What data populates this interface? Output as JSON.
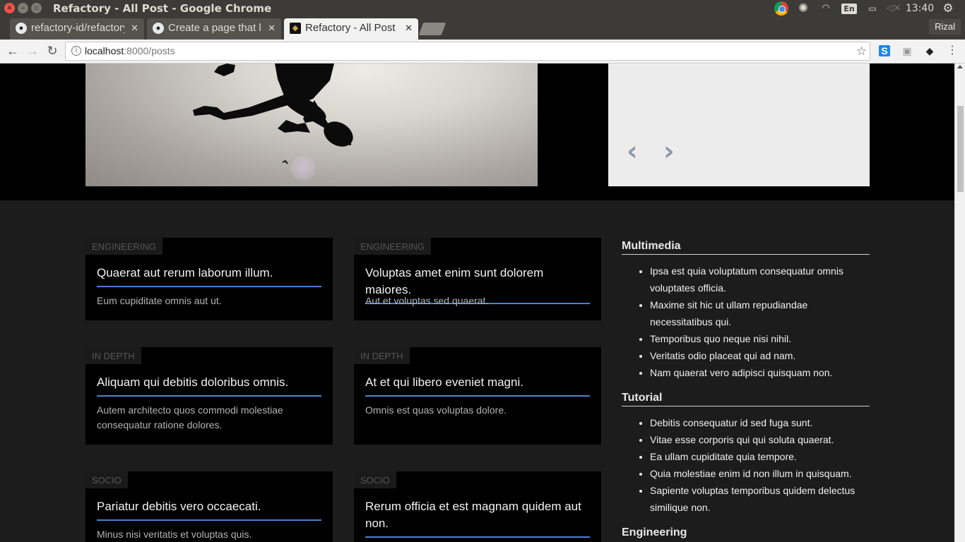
{
  "window": {
    "title": "Refactory - All Post - Google Chrome",
    "tray": {
      "lang": "En",
      "time": "13:40"
    }
  },
  "browser": {
    "tabs": [
      {
        "title": "refactory-id/refactory",
        "favicon": "github-icon",
        "active": false
      },
      {
        "title": "Create a page that lists",
        "favicon": "github-icon",
        "active": false
      },
      {
        "title": "Refactory - All Post",
        "favicon": "site-icon",
        "active": true
      }
    ],
    "profile": "Rizal",
    "url_host": "localhost",
    "url_path": ":8000/posts"
  },
  "hero": {
    "prev_label": "‹",
    "next_label": "›"
  },
  "posts": [
    {
      "category": "Engineering",
      "title": "Quaerat aut rerum laborum illum.",
      "excerpt": "Eum cupiditate omnis aut ut."
    },
    {
      "category": "Engineering",
      "title": "Voluptas amet enim sunt dolorem maiores.",
      "excerpt": "Aut et voluptas sed quaerat."
    },
    {
      "category": "In Depth",
      "title": "Aliquam qui debitis doloribus omnis.",
      "excerpt": "Autem architecto quos commodi molestiae consequatur ratione dolores."
    },
    {
      "category": "In Depth",
      "title": "At et qui libero eveniet magni.",
      "excerpt": "Omnis est quas voluptas dolore."
    },
    {
      "category": "Socio",
      "title": "Pariatur debitis vero occaecati.",
      "excerpt": "Minus nisi veritatis et voluptas quis."
    },
    {
      "category": "Socio",
      "title": "Rerum officia et est magnam quidem aut non.",
      "excerpt": ""
    }
  ],
  "sidebar": {
    "sections": [
      {
        "heading": "Multimedia",
        "items": [
          "Ipsa est quia voluptatum consequatur omnis voluptates officia.",
          "Maxime sit hic ut ullam repudiandae necessitatibus qui.",
          "Temporibus quo neque nisi nihil.",
          "Veritatis odio placeat qui ad nam.",
          "Nam quaerat vero adipisci quisquam non."
        ]
      },
      {
        "heading": "Tutorial",
        "items": [
          "Debitis consequatur id sed fuga sunt.",
          "Vitae esse corporis qui qui soluta quaerat.",
          "Ea ullam cupiditate quia tempore.",
          "Quia molestiae enim id non illum in quisquam.",
          "Sapiente voluptas temporibus quidem delectus similique non."
        ]
      },
      {
        "heading": "Engineering",
        "items": []
      }
    ]
  }
}
